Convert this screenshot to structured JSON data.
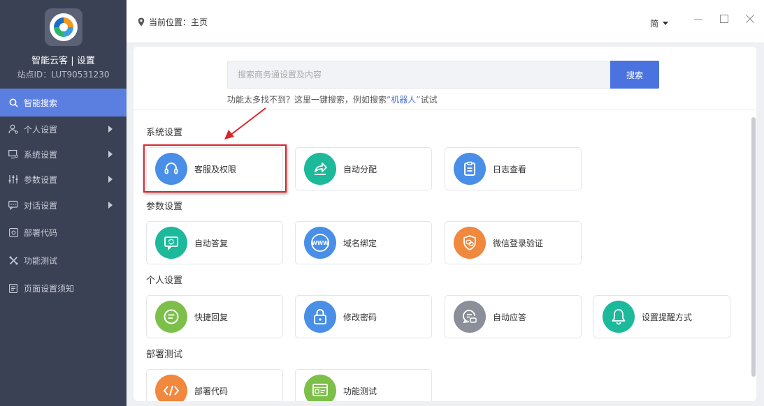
{
  "app": {
    "title": "智能云客 | 设置",
    "station_id": "站点ID：LUT90531230"
  },
  "sidebar": {
    "items": [
      {
        "label": "智能搜索",
        "icon": "search-icon",
        "active": true,
        "has_arrow": false
      },
      {
        "label": "个人设置",
        "icon": "user-settings-icon",
        "active": false,
        "has_arrow": true
      },
      {
        "label": "系统设置",
        "icon": "monitor-gear-icon",
        "active": false,
        "has_arrow": true
      },
      {
        "label": "参数设置",
        "icon": "sliders-icon",
        "active": false,
        "has_arrow": true
      },
      {
        "label": "对话设置",
        "icon": "chat-settings-icon",
        "active": false,
        "has_arrow": true
      },
      {
        "label": "部署代码",
        "icon": "code-icon",
        "active": false,
        "has_arrow": false
      },
      {
        "label": "功能测试",
        "icon": "test-icon",
        "active": false,
        "has_arrow": false
      },
      {
        "label": "页面设置须知",
        "icon": "document-icon",
        "active": false,
        "has_arrow": false
      }
    ]
  },
  "topbar": {
    "location": "当前位置：主页",
    "language": "简"
  },
  "search": {
    "placeholder": "搜索商务通设置及内容",
    "button": "搜索",
    "hint_prefix": "功能太多找不到？这里一键搜索，例如搜索",
    "hint_keyword": "“机器人”",
    "hint_suffix": "试试"
  },
  "sections": [
    {
      "title": "系统设置",
      "tiles": [
        {
          "label": "客服及权限",
          "icon": "headset-icon",
          "color": "#4a8fe7"
        },
        {
          "label": "自动分配",
          "icon": "share-arrow-icon",
          "color": "#1cb99a"
        },
        {
          "label": "日志查看",
          "icon": "clipboard-icon",
          "color": "#4a8fe7"
        }
      ]
    },
    {
      "title": "参数设置",
      "tiles": [
        {
          "label": "自动答复",
          "icon": "auto-reply-icon",
          "color": "#1cb99a"
        },
        {
          "label": "域名绑定",
          "icon": "www-icon",
          "color": "#4a8fe7"
        },
        {
          "label": "微信登录验证",
          "icon": "shield-wechat-icon",
          "color": "#f0883e"
        }
      ]
    },
    {
      "title": "个人设置",
      "tiles": [
        {
          "label": "快捷回复",
          "icon": "quick-reply-icon",
          "color": "#7cc04a"
        },
        {
          "label": "修改密码",
          "icon": "lock-icon",
          "color": "#4a8fe7"
        },
        {
          "label": "自动应答",
          "icon": "auto-answer-icon",
          "color": "#8a8f99"
        },
        {
          "label": "设置提醒方式",
          "icon": "bell-icon",
          "color": "#1cb99a"
        }
      ]
    },
    {
      "title": "部署测试",
      "tiles": [
        {
          "label": "部署代码",
          "icon": "code-brackets-icon",
          "color": "#f0883e"
        },
        {
          "label": "功能测试",
          "icon": "browser-test-icon",
          "color": "#7cc04a"
        }
      ]
    }
  ]
}
